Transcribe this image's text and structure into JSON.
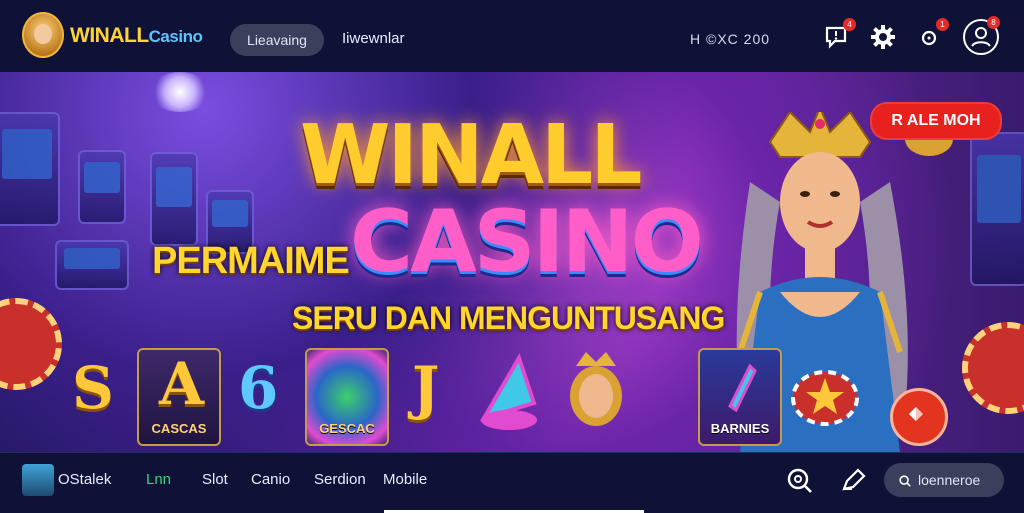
{
  "header": {
    "brand_main": "WINALL",
    "brand_sub": "Casino",
    "pill_label": "Lieavaing",
    "nav_link": "Iiwewnlar",
    "code_text": "H  ©XC 200",
    "icons": [
      "chat-alert-icon",
      "gear-icon",
      "notification-icon",
      "profile-icon"
    ],
    "badges": [
      "4",
      "1",
      "8"
    ]
  },
  "banner": {
    "title_line1": "WINALL",
    "title_line2": "CASINO",
    "prefix": "PERMAIME",
    "tagline": "SERU DAN MENGUNTUSANG",
    "promo_button": "R ALE MOH",
    "tiles": [
      {
        "glyph": "S",
        "label": ""
      },
      {
        "glyph": "A",
        "label": "CASCAS"
      },
      {
        "glyph": "6",
        "label": ""
      },
      {
        "glyph": "",
        "label": "GESCAC"
      },
      {
        "glyph": "J",
        "label": ""
      },
      {
        "glyph": "",
        "label": ""
      },
      {
        "glyph": "",
        "label": ""
      },
      {
        "glyph": "",
        "label": "BARNIES"
      },
      {
        "glyph": "",
        "label": ""
      }
    ],
    "accent_gold": "#ffcc2e",
    "accent_pink": "#ff5ec8",
    "accent_red": "#e8211f"
  },
  "footer": {
    "profile_name": "OStalek",
    "tab_active": "Lnn",
    "tabs": [
      "Slot",
      "Canio",
      "Serdion",
      "Mobile"
    ],
    "search_placeholder": "loenneroe"
  }
}
